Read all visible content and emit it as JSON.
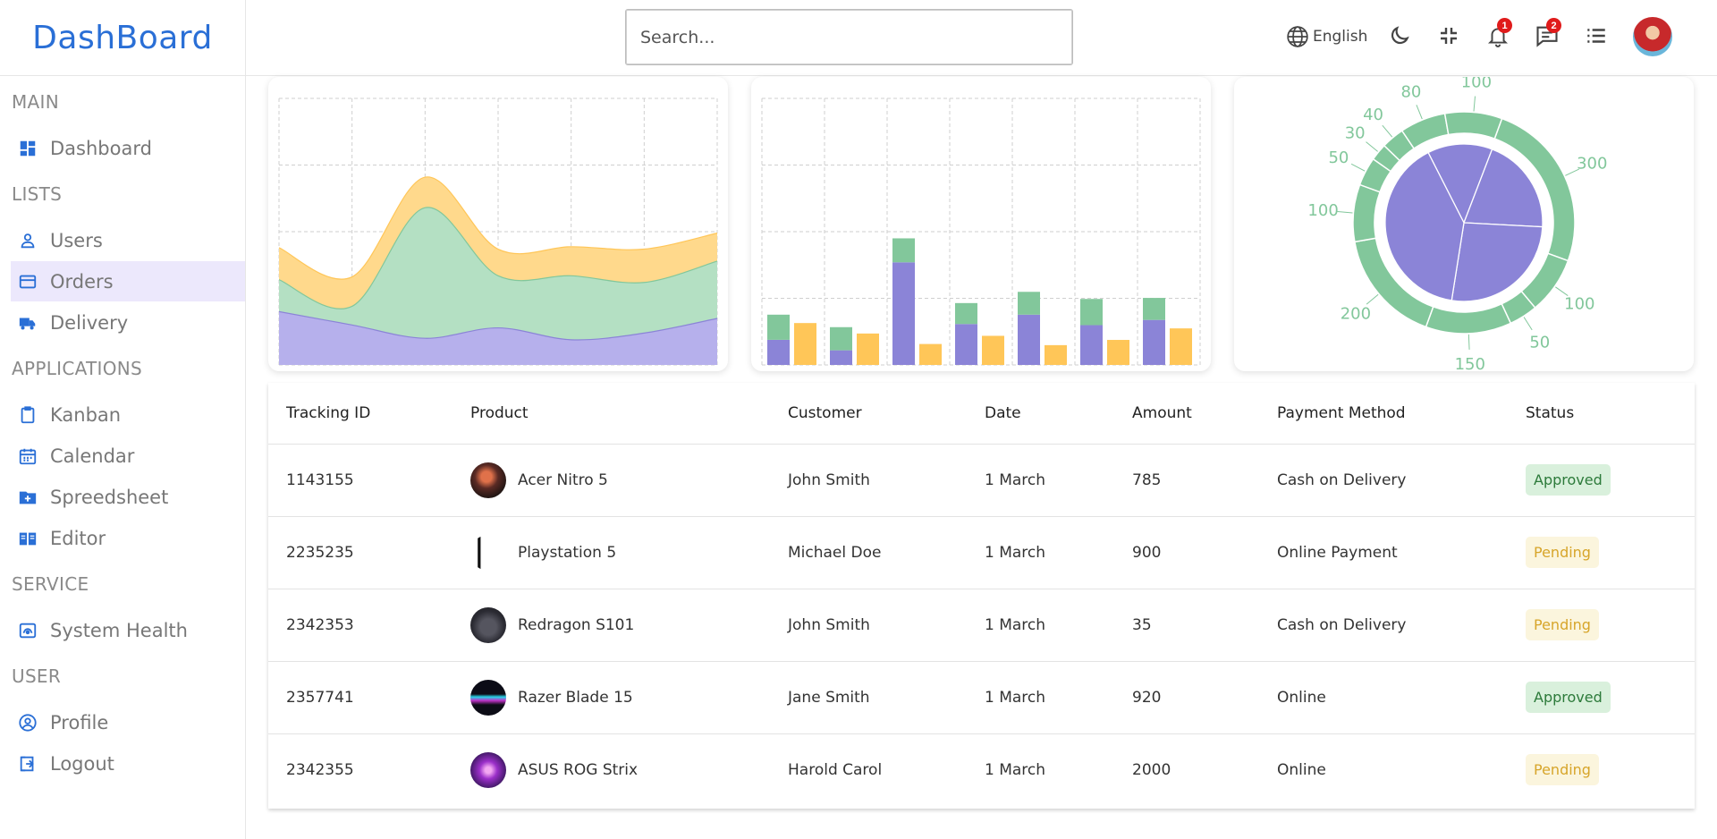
{
  "logo": "DashBoard",
  "search": {
    "placeholder": "Search..."
  },
  "header": {
    "language": "English",
    "notifications_count": "1",
    "messages_count": "2"
  },
  "sidebar": {
    "sections": [
      {
        "title": "MAIN",
        "items": [
          {
            "label": "Dashboard",
            "icon": "dashboard-icon"
          }
        ]
      },
      {
        "title": "LISTS",
        "items": [
          {
            "label": "Users",
            "icon": "user-icon"
          },
          {
            "label": "Orders",
            "icon": "credit-card-icon",
            "active": true
          },
          {
            "label": "Delivery",
            "icon": "truck-icon"
          }
        ]
      },
      {
        "title": "APPLICATIONS",
        "items": [
          {
            "label": "Kanban",
            "icon": "clipboard-icon"
          },
          {
            "label": "Calendar",
            "icon": "calendar-icon"
          },
          {
            "label": "Spreedsheet",
            "icon": "folder-plus-icon"
          },
          {
            "label": "Editor",
            "icon": "book-icon"
          }
        ]
      },
      {
        "title": "SERVICE",
        "items": [
          {
            "label": "System Health",
            "icon": "health-icon"
          }
        ]
      },
      {
        "title": "USER",
        "items": [
          {
            "label": "Profile",
            "icon": "profile-icon"
          },
          {
            "label": "Logout",
            "icon": "logout-icon"
          }
        ]
      }
    ]
  },
  "colors": {
    "accent": "#2a6fd6",
    "purple": "#8b84d7",
    "green": "#82c79b",
    "yellow": "#ffc658",
    "active_bg": "#ece8fc"
  },
  "chart_data": [
    {
      "type": "area",
      "stacked": true,
      "series": [
        {
          "values": [
            4000,
            3000,
            2000,
            2780,
            1890,
            2390,
            3490
          ]
        },
        {
          "values": [
            2400,
            1398,
            9800,
            3908,
            4800,
            3800,
            4300
          ]
        },
        {
          "values": [
            2400,
            2210,
            2290,
            2000,
            2181,
            2500,
            2100
          ]
        }
      ],
      "ylim": [
        0,
        20000
      ],
      "grid": true
    },
    {
      "type": "bar",
      "stacked_series": [
        {
          "values": [
            2400,
            1398,
            9800,
            3908,
            4800,
            3800,
            4300
          ]
        },
        {
          "values": [
            2400,
            2210,
            2290,
            2000,
            2181,
            2500,
            2100
          ]
        }
      ],
      "side_series": [
        {
          "values": [
            4000,
            3000,
            2000,
            2780,
            1890,
            2390,
            3490
          ]
        }
      ],
      "ylim": [
        0,
        14000
      ],
      "grid": true
    },
    {
      "type": "pie",
      "inner_values": [
        100,
        150,
        200,
        300
      ],
      "outer_labels": [
        "300",
        "100",
        "50",
        "150",
        "200",
        "100",
        "50",
        "30",
        "40",
        "80",
        "100"
      ]
    }
  ],
  "table": {
    "headers": [
      "Tracking ID",
      "Product",
      "Customer",
      "Date",
      "Amount",
      "Payment Method",
      "Status"
    ],
    "rows": [
      {
        "id": "1143155",
        "product": "Acer Nitro 5",
        "customer": "John Smith",
        "date": "1 March",
        "amount": "785",
        "method": "Cash on Delivery",
        "status": "Approved"
      },
      {
        "id": "2235235",
        "product": "Playstation 5",
        "customer": "Michael Doe",
        "date": "1 March",
        "amount": "900",
        "method": "Online Payment",
        "status": "Pending"
      },
      {
        "id": "2342353",
        "product": "Redragon S101",
        "customer": "John Smith",
        "date": "1 March",
        "amount": "35",
        "method": "Cash on Delivery",
        "status": "Pending"
      },
      {
        "id": "2357741",
        "product": "Razer Blade 15",
        "customer": "Jane Smith",
        "date": "1 March",
        "amount": "920",
        "method": "Online",
        "status": "Approved"
      },
      {
        "id": "2342355",
        "product": "ASUS ROG Strix",
        "customer": "Harold Carol",
        "date": "1 March",
        "amount": "2000",
        "method": "Online",
        "status": "Pending"
      }
    ]
  }
}
